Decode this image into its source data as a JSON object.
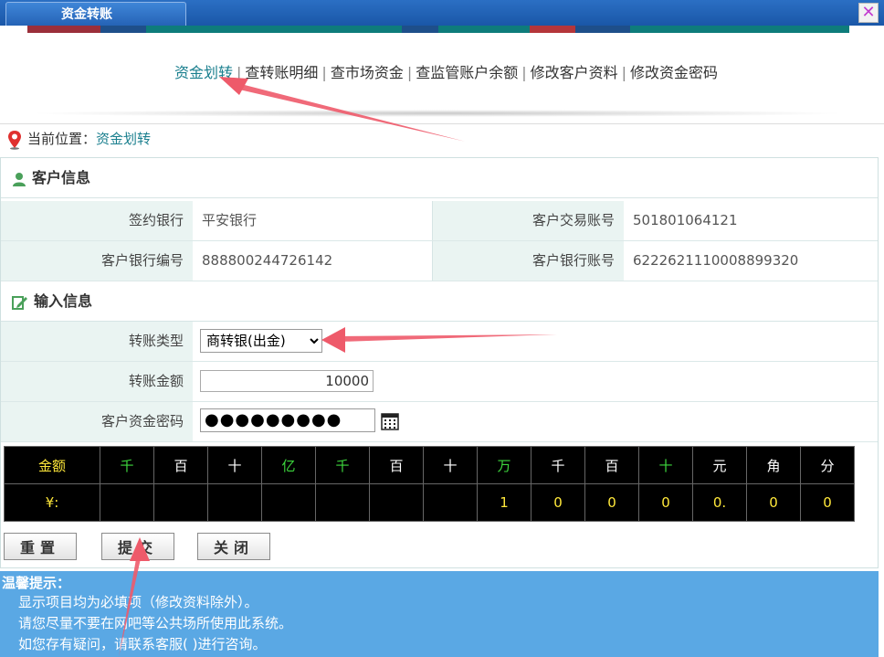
{
  "window": {
    "title": "资金转账",
    "close_icon": "close-icon"
  },
  "strip_colors": [
    "#9b2f3a",
    "#1e4f8a",
    "#0e7c7b",
    "#0e7c7b",
    "#b5363a",
    "#1e4f8a",
    "#0e7c7b"
  ],
  "nav": {
    "items": [
      "资金划转",
      "查转账明细",
      "查市场资金",
      "查监管账户余额",
      "修改客户资料",
      "修改资金密码"
    ],
    "separator": "|"
  },
  "location": {
    "label": "当前位置：",
    "value": "资金划转"
  },
  "customer": {
    "heading": "客户信息",
    "sign_bank_label": "签约银行",
    "sign_bank": "平安银行",
    "trade_account_label": "客户交易账号",
    "trade_account": "501801064121",
    "bank_code_label": "客户银行编号",
    "bank_code": "888800244726142",
    "bank_account_label": "客户银行账号",
    "bank_account": "6222621110008899320"
  },
  "input": {
    "heading": "输入信息",
    "type_label": "转账类型",
    "type_value": "商转银(出金)",
    "amount_label": "转账金额",
    "amount_value": "10000",
    "password_label": "客户资金密码",
    "password_mask": "●●●●●●●●●"
  },
  "grid": {
    "header": [
      "金额",
      "千",
      "百",
      "十",
      "亿",
      "千",
      "百",
      "十",
      "万",
      "千",
      "百",
      "十",
      "元",
      "角",
      "分"
    ],
    "values": [
      "¥:",
      "",
      "",
      "",
      "",
      "",
      "",
      "",
      "1",
      "0",
      "0",
      "0",
      "0.",
      "0",
      "0"
    ]
  },
  "buttons": {
    "reset": "重置",
    "submit": "提交",
    "close": "关闭"
  },
  "tips": {
    "title": "温馨提示：",
    "lines": [
      "显示项目均为必填项（修改资料除外）。",
      "请您尽量不要在网吧等公共场所使用此系统。",
      "如您存有疑问，请联系客服( )进行咨询。"
    ]
  },
  "colors": {
    "accent": "#1a7f8e",
    "label_bg": "#eaf4f2",
    "tips_bg": "#5aa8e4",
    "arrow": "#ee5a6a"
  }
}
